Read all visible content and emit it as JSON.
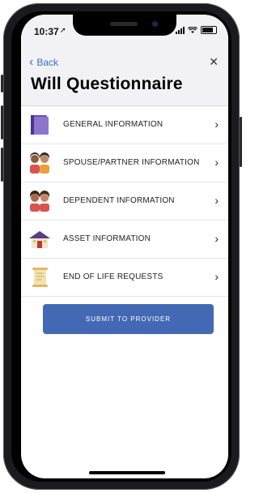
{
  "status": {
    "time": "10:37"
  },
  "nav": {
    "back_label": "Back",
    "title": "Will Questionnaire"
  },
  "sections": [
    {
      "label": "GENERAL INFORMATION",
      "icon": "binder-icon"
    },
    {
      "label": "SPOUSE/PARTNER INFORMATION",
      "icon": "couple-icon"
    },
    {
      "label": "DEPENDENT INFORMATION",
      "icon": "dependents-icon"
    },
    {
      "label": "ASSET INFORMATION",
      "icon": "house-icon"
    },
    {
      "label": "END OF LIFE REQUESTS",
      "icon": "scroll-icon"
    }
  ],
  "submit": {
    "label": "SUBMIT TO PROVIDER"
  },
  "colors": {
    "accent": "#2f6fd6",
    "submit_bg": "#4469b4"
  }
}
